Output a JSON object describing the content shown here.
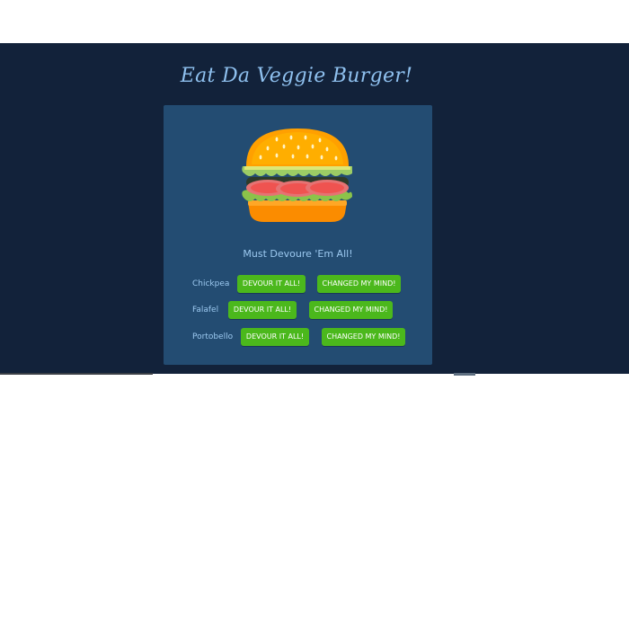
{
  "app": {
    "title": "Eat Da Veggie Burger!",
    "subtitle": "Must Devoure 'Em All!"
  },
  "burger_image": {
    "icon": "burger-icon"
  },
  "burgers": [
    {
      "name": "Chickpea",
      "devour_label": "DEVOUR IT ALL!",
      "change_label": "CHANGED MY MIND!"
    },
    {
      "name": "Falafel",
      "devour_label": "DEVOUR IT ALL!",
      "change_label": "CHANGED MY MIND!"
    },
    {
      "name": "Portobello",
      "devour_label": "DEVOUR IT ALL!",
      "change_label": "CHANGED MY MIND!"
    }
  ],
  "colors": {
    "background": "#12223a",
    "card": "#234c72",
    "accent_text": "#8fc1ef",
    "button": "#4bb81c"
  }
}
